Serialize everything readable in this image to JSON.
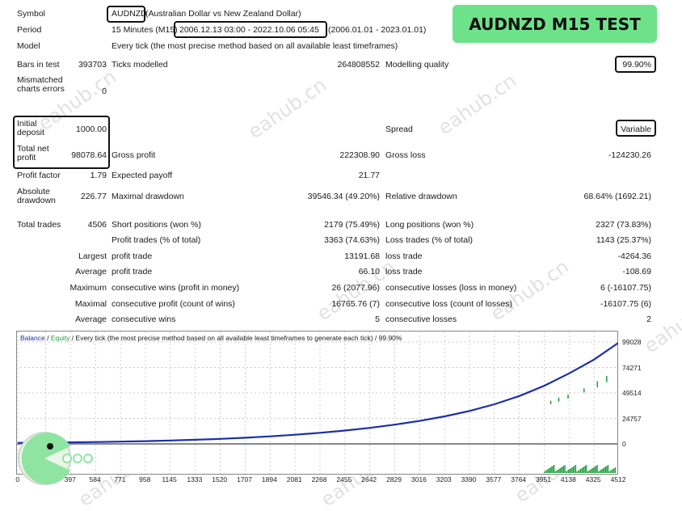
{
  "header": {
    "symbol_label": "Symbol",
    "symbol_value": "AUDNZD",
    "symbol_desc": "(Australian Dollar vs New Zealand Dollar)",
    "period_label": "Period",
    "period_prefix": "15 Minutes (M15)",
    "period_range": "2006.12.13 03:00 - 2022.10.06 05:45",
    "period_suffix": "(2006.01.01 - 2023.01.01)",
    "model_label": "Model",
    "model_value": "Every tick (the most precise method based on all available least timeframes)",
    "badge": "AUDNZD M15 TEST"
  },
  "stats": {
    "bars_label": "Bars in test",
    "bars_value": "393703",
    "ticks_label": "Ticks modelled",
    "ticks_value": "264808552",
    "quality_label": "Modelling quality",
    "quality_value": "99.90%",
    "mismatch_label": "Mismatched charts errors",
    "mismatch_value": "0",
    "deposit_label": "Initial deposit",
    "deposit_value": "1000.00",
    "spread_label": "Spread",
    "spread_value": "Variable",
    "netprofit_label": "Total net profit",
    "netprofit_value": "98078.64",
    "grossprofit_label": "Gross profit",
    "grossprofit_value": "222308.90",
    "grossloss_label": "Gross loss",
    "grossloss_value": "-124230.26",
    "pf_label": "Profit factor",
    "pf_value": "1.79",
    "payoff_label": "Expected payoff",
    "payoff_value": "21.77",
    "absdd_label": "Absolute drawdown",
    "absdd_value": "226.77",
    "maxdd_label": "Maximal drawdown",
    "maxdd_value": "39546.34 (49.20%)",
    "reldd_label": "Relative drawdown",
    "reldd_value": "68.64% (1692.21)",
    "trades_label": "Total trades",
    "trades_value": "4506",
    "short_label": "Short positions (won %)",
    "short_value": "2179 (75.49%)",
    "long_label": "Long positions (won %)",
    "long_value": "2327 (73.83%)",
    "ptrades_label": "Profit trades (% of total)",
    "ptrades_value": "3363 (74.63%)",
    "ltrades_label": "Loss trades (% of total)",
    "ltrades_value": "1143 (25.37%)",
    "largest_label": "Largest",
    "lg_profit_label": "profit trade",
    "lg_profit_value": "13191.68",
    "lg_loss_label": "loss trade",
    "lg_loss_value": "-4264.36",
    "average_label": "Average",
    "av_profit_label": "profit trade",
    "av_profit_value": "66.10",
    "av_loss_label": "loss trade",
    "av_loss_value": "-108.69",
    "maximum_label": "Maximum",
    "mx_wins_label": "consecutive wins (profit in money)",
    "mx_wins_value": "26 (2077.96)",
    "mx_losses_label": "consecutive losses (loss in money)",
    "mx_losses_value": "6 (-16107.75)",
    "maximal_label": "Maximal",
    "ml_profit_label": "consecutive profit (count of wins)",
    "ml_profit_value": "16765.76 (7)",
    "ml_loss_label": "consecutive loss (count of losses)",
    "ml_loss_value": "-16107.75 (6)",
    "avg2_label": "Average",
    "avg_wins_label": "consecutive wins",
    "avg_wins_value": "5",
    "avg_losses_label": "consecutive losses",
    "avg_losses_value": "2"
  },
  "chart_legend": {
    "balance": "Balance",
    "sep1": " / ",
    "equity": "Equity",
    "rest": " / Every tick (the most precise method based on all available least timeframes to generate each tick) / 99.90%"
  },
  "watermark": "eahub.cn",
  "chart_data": {
    "type": "line",
    "x_ticks": [
      "0",
      "210",
      "397",
      "584",
      "771",
      "958",
      "1145",
      "1333",
      "1520",
      "1707",
      "1894",
      "2081",
      "2268",
      "2455",
      "2642",
      "2829",
      "3016",
      "3203",
      "3390",
      "3577",
      "3764",
      "3951",
      "4138",
      "4325",
      "4512"
    ],
    "y_ticks": [
      "99028",
      "74271",
      "49514",
      "24757",
      "0"
    ],
    "ylim": [
      -2000,
      99028
    ],
    "xlim": [
      0,
      4506
    ],
    "series": [
      {
        "name": "Balance",
        "color": "#1b2fa8",
        "x": [
          0,
          210,
          397,
          584,
          771,
          958,
          1145,
          1333,
          1520,
          1707,
          1894,
          2081,
          2268,
          2455,
          2642,
          2829,
          3016,
          3203,
          3390,
          3577,
          3764,
          3951,
          4138,
          4325,
          4506
        ],
        "y": [
          1000,
          1250,
          1500,
          1800,
          2200,
          2700,
          3300,
          4000,
          4900,
          6000,
          7300,
          8900,
          10800,
          13000,
          15600,
          18700,
          22300,
          26700,
          32000,
          38500,
          46500,
          56500,
          68500,
          82000,
          98079
        ]
      },
      {
        "name": "Equity",
        "color": "#1f9e3c",
        "x": [],
        "y": []
      }
    ],
    "equity_dips": [
      [
        4000,
        38500,
        42000
      ],
      [
        4060,
        41000,
        45000
      ],
      [
        4130,
        44000,
        48000
      ],
      [
        4250,
        50000,
        54000
      ],
      [
        4350,
        55000,
        61000
      ],
      [
        4420,
        60000,
        66000
      ]
    ]
  },
  "colors": {
    "badge_bg": "#6ee28a",
    "balance": "#1b2fa8",
    "equity": "#1f9e3c"
  }
}
